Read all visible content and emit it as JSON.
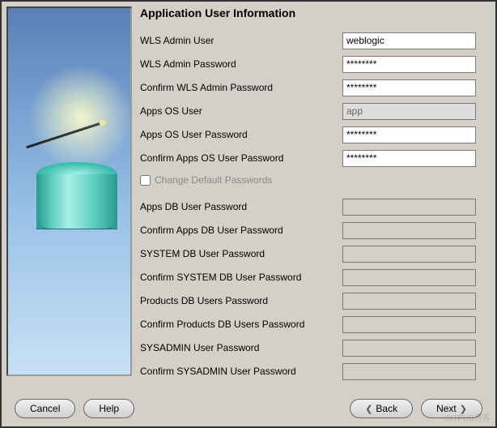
{
  "title": "Application User Information",
  "fields": {
    "wls_admin_user": {
      "label": "WLS Admin User",
      "value": "weblogic"
    },
    "wls_admin_pw": {
      "label": "WLS Admin Password",
      "value": "********"
    },
    "wls_admin_pw2": {
      "label": "Confirm WLS Admin Password",
      "value": "********"
    },
    "apps_os_user": {
      "label": "Apps OS User",
      "value": "app"
    },
    "apps_os_pw": {
      "label": "Apps OS User Password",
      "value": "********"
    },
    "apps_os_pw2": {
      "label": "Confirm Apps OS User Password",
      "value": "********"
    }
  },
  "checkbox": {
    "label": "Change Default Passwords"
  },
  "locked": {
    "apps_db_pw": "Apps DB User Password",
    "apps_db_pw2": "Confirm Apps DB User Password",
    "system_db_pw": "SYSTEM DB User Password",
    "system_db_pw2": "Confirm SYSTEM DB User Password",
    "products_db_pw": "Products DB Users Password",
    "products_db_pw2": "Confirm Products DB Users Password",
    "sysadmin_pw": "SYSADMIN User Password",
    "sysadmin_pw2": "Confirm SYSADMIN User Password"
  },
  "buttons": {
    "cancel": "Cancel",
    "help": "Help",
    "back": "Back",
    "next": "Next"
  },
  "watermark": "©ITPUB博客"
}
